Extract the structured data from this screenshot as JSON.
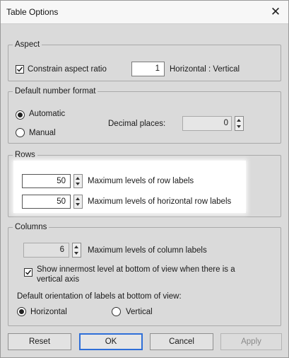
{
  "dialog": {
    "title": "Table Options",
    "close_glyph": "✕"
  },
  "aspect": {
    "legend": "Aspect",
    "constrain_label": "Constrain aspect ratio",
    "constrain_checked": true,
    "ratio_value": "1",
    "ratio_suffix": "Horizontal : Vertical"
  },
  "number_format": {
    "legend": "Default number format",
    "automatic_label": "Automatic",
    "manual_label": "Manual",
    "selected": "Automatic",
    "decimal_label": "Decimal places:",
    "decimal_value": "0"
  },
  "rows": {
    "legend": "Rows",
    "row_levels_value": "50",
    "row_levels_label": "Maximum levels of row labels",
    "horizontal_levels_value": "50",
    "horizontal_levels_label": "Maximum levels of horizontal row labels"
  },
  "columns": {
    "legend": "Columns",
    "column_levels_value": "6",
    "column_levels_label": "Maximum levels of column labels",
    "innermost_label_line1": "Show innermost level at bottom of view when there is a",
    "innermost_label_line2": "vertical axis",
    "innermost_checked": true,
    "orientation_label": "Default orientation of labels at bottom of view:",
    "horizontal_label": "Horizontal",
    "vertical_label": "Vertical",
    "orientation_selected": "Horizontal"
  },
  "buttons": {
    "reset": "Reset",
    "ok": "OK",
    "cancel": "Cancel",
    "apply": "Apply"
  },
  "colors": {
    "default_button_border": "#2f6fd8",
    "dialog_bg": "#dadada",
    "titlebar_bg": "#f7f7f7"
  },
  "icons": {
    "close": "close-icon",
    "check": "checkmark-icon",
    "spinner": "spinner-arrows-icon"
  }
}
